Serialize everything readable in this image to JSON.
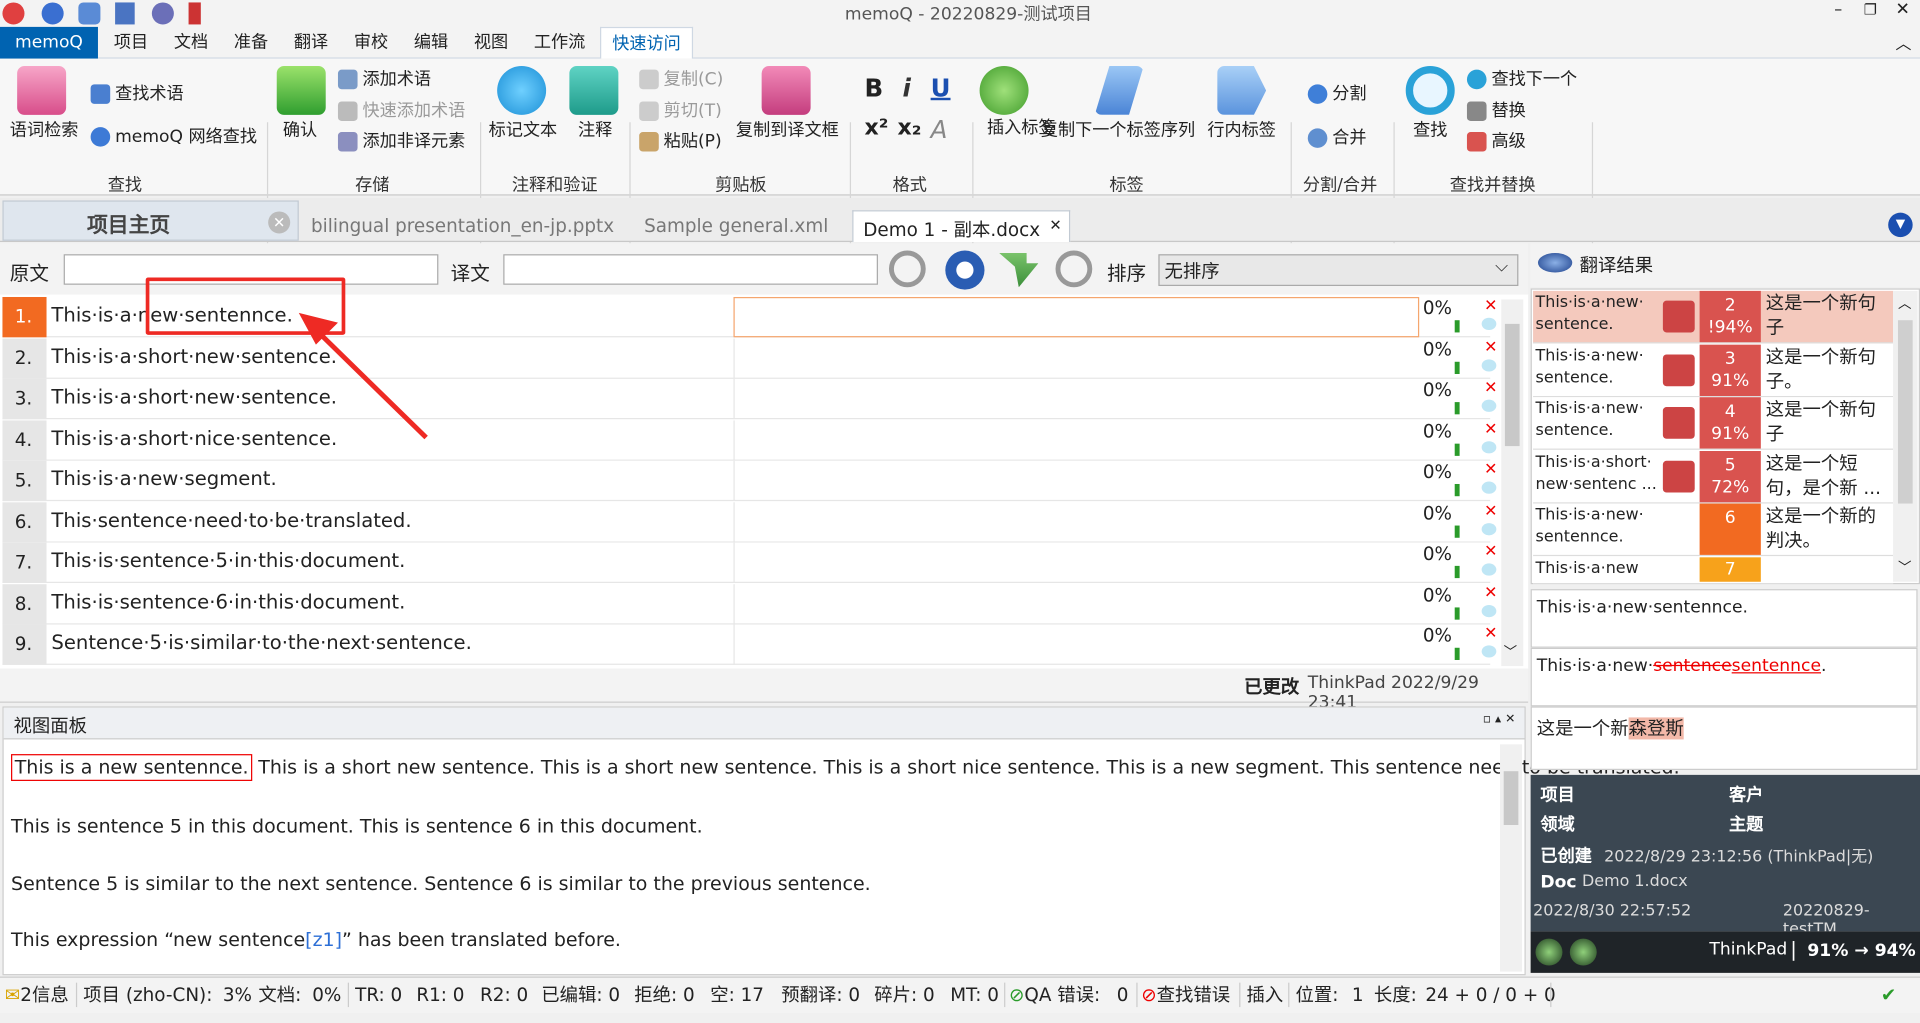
{
  "window": {
    "title": "memoQ - 20220829-测试项目"
  },
  "menu": {
    "app": "memoQ",
    "items": [
      "项目",
      "文档",
      "准备",
      "翻译",
      "审校",
      "编辑",
      "视图",
      "工作流",
      "快速访问"
    ]
  },
  "ribbon": {
    "lookup": "语词检索",
    "find_term": "查找术语",
    "web_search": "memoQ 网络查找",
    "group_find": "查找",
    "confirm": "确认",
    "add_term": "添加术语",
    "quick_add_term": "快速添加术语",
    "add_nontrans": "添加非译元素",
    "group_store": "存储",
    "mark_text": "标记文本",
    "comment": "注释",
    "group_comment": "注释和验证",
    "copy": "复制(C)",
    "cut": "剪切(T)",
    "paste": "粘贴(P)",
    "copy_to_target": "复制到译文框",
    "group_clip": "剪贴板",
    "group_format": "格式",
    "insert_tag": "插入标签",
    "copy_next_tag": "复制下一个标签序列",
    "inline_tag": "行内标签",
    "group_tags": "标签",
    "split": "分割",
    "merge": "合并",
    "group_split": "分割/合并",
    "find": "查找",
    "find_next": "查找下一个",
    "replace": "替换",
    "advanced": "高级",
    "group_findreplace": "查找并替换"
  },
  "tabs": {
    "home": "项目主页",
    "t1": "bilingual presentation_en-jp.pptx",
    "t2": "Sample general.xml",
    "t3": "Demo 1 - 副本.docx"
  },
  "filter": {
    "source_label": "原文",
    "target_label": "译文",
    "sort_label": "排序",
    "sort_value": "无排序"
  },
  "rows": [
    {
      "n": "1.",
      "src": "This·is·a·new·sentennce.",
      "pct": "0%"
    },
    {
      "n": "2.",
      "src": "This·is·a·short·new·sentence.",
      "pct": "0%"
    },
    {
      "n": "3.",
      "src": "This·is·a·short·new·sentence.",
      "pct": "0%"
    },
    {
      "n": "4.",
      "src": "This·is·a·short·nice·sentence.",
      "pct": "0%"
    },
    {
      "n": "5.",
      "src": "This·is·a·new·segment.",
      "pct": "0%"
    },
    {
      "n": "6.",
      "src": "This·sentence·need·to·be·translated.",
      "pct": "0%"
    },
    {
      "n": "7.",
      "src": "This·is·sentence·5·in·this·document.",
      "pct": "0%"
    },
    {
      "n": "8.",
      "src": "This·is·sentence·6·in·this·document.",
      "pct": "0%"
    },
    {
      "n": "9.",
      "src": "Sentence·5·is·similar·to·the·next·sentence.",
      "pct": "0%"
    }
  ],
  "status_line": {
    "modified": "已更改",
    "user_time": "ThinkPad 2022/9/29 23:41"
  },
  "view_panel": {
    "title": "视图面板",
    "highlight": "This is a new sentennce.",
    "p1_rest": " This is a short new sentence. This is a short new sentence. This is a short nice sentence. This is a new segment. This sentence need to be translated.",
    "p2": "This is sentence 5 in this document. This is sentence 6 in this document.",
    "p3": "Sentence 5 is similar to the next sentence. Sentence 6 is similar to the previous sentence.",
    "p4a": "This expression “new sentence",
    "p4tag": "[z1]",
    "p4b": "” has been translated before."
  },
  "results": {
    "title": "翻译结果",
    "items": [
      {
        "src": "This·is·a·new· sentence.",
        "num": "2",
        "pct": "!94%",
        "tgt": "这是一个新句子",
        "color": "#d9534f"
      },
      {
        "src": "This·is·a·new· sentence.",
        "num": "3",
        "pct": "91%",
        "tgt": "这是一个新句子。",
        "color": "#d9534f"
      },
      {
        "src": "This·is·a·new· sentence.",
        "num": "4",
        "pct": "91%",
        "tgt": "这是一个新句子",
        "color": "#d9534f"
      },
      {
        "src": "This·is·a·short· new·sentenc ...",
        "num": "5",
        "pct": "72%",
        "tgt": "这是一个短句，是个新 ...",
        "color": "#d9534f"
      },
      {
        "src": "This·is·a·new· sentennce.",
        "num": "6",
        "pct": "",
        "tgt": "这是一个新的判决。",
        "color": "#f26a21"
      },
      {
        "src": "This·is·a·new",
        "num": "7",
        "pct": "",
        "tgt": "",
        "color": "#f7a21b"
      }
    ],
    "cmp_source": "This·is·a·new·sentennce.",
    "cmp_diff_a": "This·is·a·new·",
    "cmp_diff_del": "sentence",
    "cmp_diff_ins": "sentennce",
    "cmp_diff_end": ".",
    "cmp_target_a": "这是一个新",
    "cmp_target_b": "森登斯"
  },
  "meta": {
    "project": "项目",
    "client": "客户",
    "domain": "领域",
    "subject": "主题",
    "created_label": "已创建",
    "created": "2022/8/29 23:12:56 (ThinkPad|无)",
    "doc_label": "Doc",
    "doc": "Demo 1.docx",
    "date": "2022/8/30 22:57:52",
    "tm": "20220829-testTM",
    "user": "ThinkPad",
    "score": "91% → 94%"
  },
  "statusbar": {
    "info": "2信息",
    "project": "项目 (zho-CN):",
    "p_pct": "3%",
    "doc": "文档:",
    "d_pct": "0%",
    "tr": "TR: 0",
    "r1": "R1: 0",
    "r2": "R2: 0",
    "edited": "已编辑: 0",
    "rejected": "拒绝: 0",
    "empty": "空: 17",
    "pretrans": "预翻译: 0",
    "frag": "碎片: 0",
    "mt": "MT: 0",
    "qa": "QA 错误:",
    "qa_n": "0",
    "finderr": "查找错误",
    "insert": "插入",
    "pos": "位置:",
    "pos_n": "1",
    "len": "长度:",
    "len_v": "24 + 0 / 0 + 0"
  },
  "colors": {
    "accent": "#0063b1",
    "active_row": "#f26a21",
    "annotation": "#ee2a24"
  }
}
